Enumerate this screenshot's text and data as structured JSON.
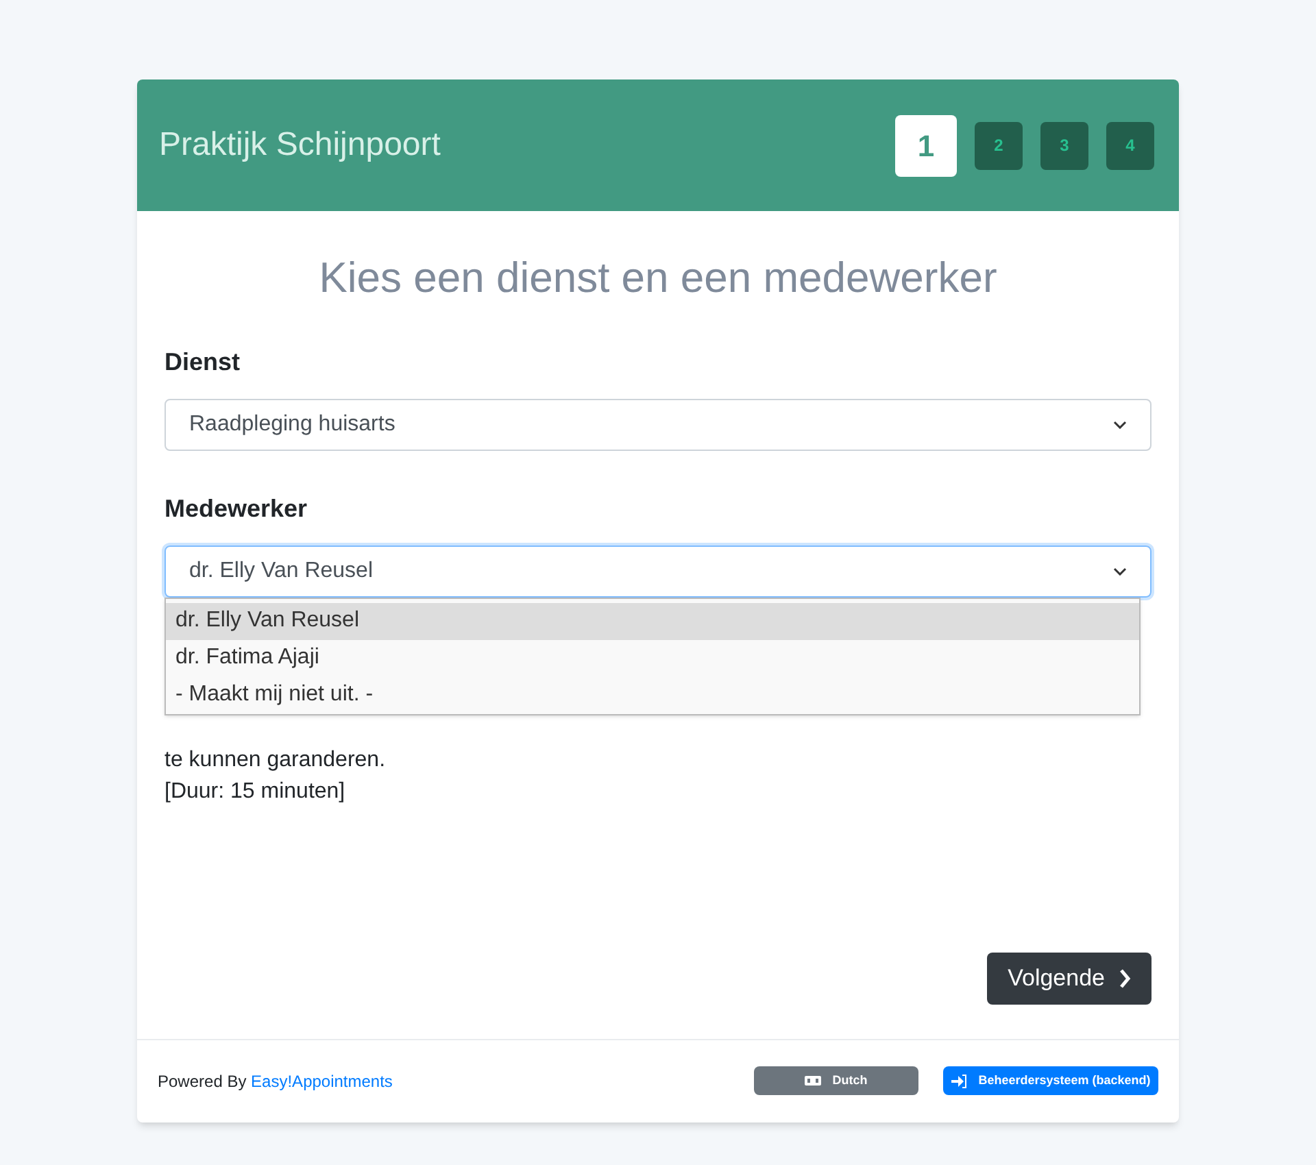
{
  "header": {
    "title": "Praktijk Schijnpoort",
    "steps": [
      {
        "label": "1",
        "selected": true
      },
      {
        "label": "2",
        "selected": false
      },
      {
        "label": "3",
        "selected": false
      },
      {
        "label": "4",
        "selected": false
      }
    ]
  },
  "heading": "Kies een dienst en een medewerker",
  "service": {
    "label": "Dienst",
    "value": "Raadpleging huisarts"
  },
  "provider": {
    "label": "Medewerker",
    "value": "dr. Elly Van Reusel",
    "expanded": true,
    "options": [
      {
        "label": "dr. Elly Van Reusel",
        "selected": true
      },
      {
        "label": "dr. Fatima Ajaji",
        "selected": false
      },
      {
        "label": "- Maakt mij niet uit. -",
        "selected": false
      }
    ]
  },
  "description": [
    "te kunnen garanderen.",
    "[Duur: 15 minuten]"
  ],
  "next_button": "Volgende",
  "footer": {
    "powered_by": "Powered By",
    "link": "Easy!Appointments",
    "language_button": "Dutch",
    "backend_button": "Beheerdersysteem (backend)"
  }
}
